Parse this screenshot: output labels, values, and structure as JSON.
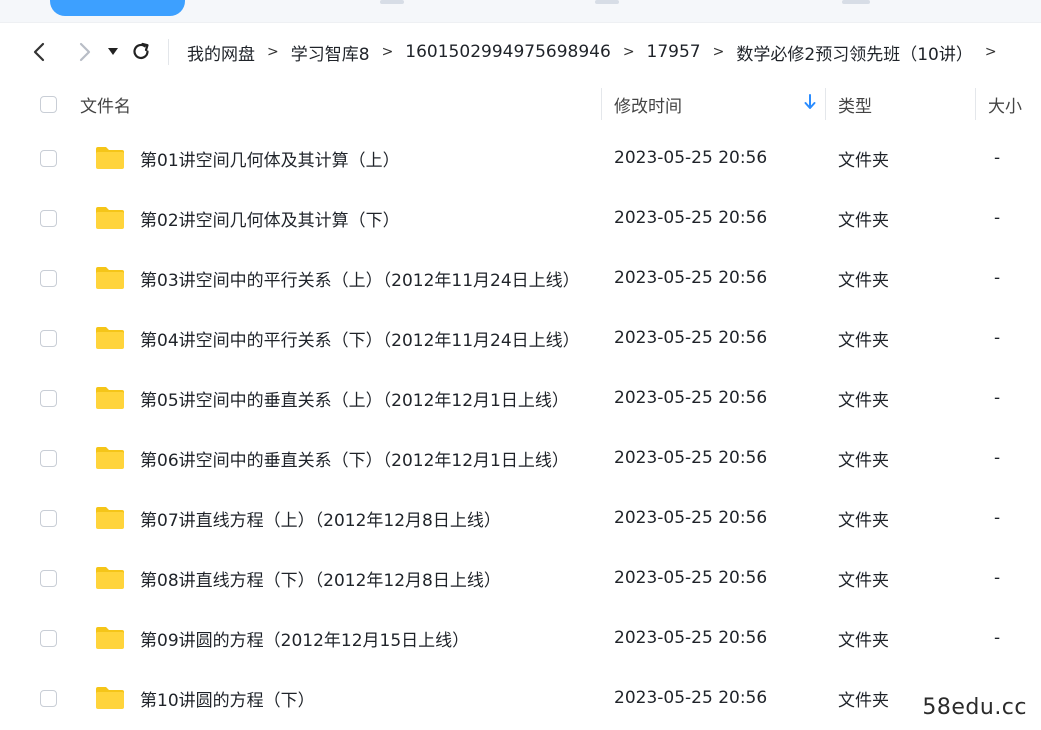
{
  "nav": {
    "back_icon": "back-arrow-icon",
    "forward_icon": "forward-arrow-icon",
    "history_icon": "dropdown-caret-icon",
    "refresh_icon": "refresh-icon"
  },
  "breadcrumb": [
    "我的网盘",
    "学习智库8",
    "1601502994975698946",
    "17957",
    "数学必修2预习领先班（10讲）"
  ],
  "table": {
    "headers": {
      "name": "文件名",
      "modified": "修改时间",
      "type": "类型",
      "size": "大小"
    },
    "sort_icon": "sort-down-arrow-icon",
    "rows": [
      {
        "name": "第01讲空间几何体及其计算（上）",
        "modified": "2023-05-25 20:56",
        "type": "文件夹",
        "size": "-"
      },
      {
        "name": "第02讲空间几何体及其计算（下）",
        "modified": "2023-05-25 20:56",
        "type": "文件夹",
        "size": "-"
      },
      {
        "name": "第03讲空间中的平行关系（上）（2012年11月24日上线）",
        "modified": "2023-05-25 20:56",
        "type": "文件夹",
        "size": "-"
      },
      {
        "name": "第04讲空间中的平行关系（下）（2012年11月24日上线）",
        "modified": "2023-05-25 20:56",
        "type": "文件夹",
        "size": "-"
      },
      {
        "name": "第05讲空间中的垂直关系（上）（2012年12月1日上线）",
        "modified": "2023-05-25 20:56",
        "type": "文件夹",
        "size": "-"
      },
      {
        "name": "第06讲空间中的垂直关系（下）（2012年12月1日上线）",
        "modified": "2023-05-25 20:56",
        "type": "文件夹",
        "size": "-"
      },
      {
        "name": "第07讲直线方程（上）（2012年12月8日上线）",
        "modified": "2023-05-25 20:56",
        "type": "文件夹",
        "size": "-"
      },
      {
        "name": "第08讲直线方程（下）（2012年12月8日上线）",
        "modified": "2023-05-25 20:56",
        "type": "文件夹",
        "size": "-"
      },
      {
        "name": "第09讲圆的方程（2012年12月15日上线）",
        "modified": "2023-05-25 20:56",
        "type": "文件夹",
        "size": "-"
      },
      {
        "name": "第10讲圆的方程（下）",
        "modified": "2023-05-25 20:56",
        "type": "文件夹",
        "size": ""
      }
    ]
  },
  "watermark": "58edu.cc",
  "colors": {
    "folder": "#ffd43b",
    "folder_dark": "#f5c518",
    "accent": "#2a8cff",
    "top_button": "#3da0ff"
  }
}
